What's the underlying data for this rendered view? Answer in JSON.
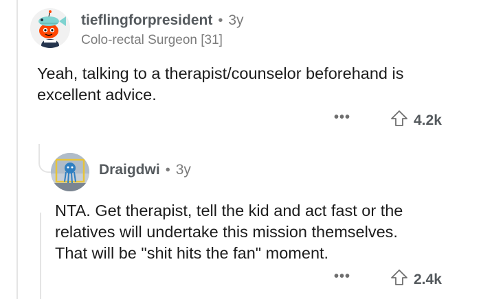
{
  "comments": [
    {
      "username": "tieflingforpresident",
      "separator": "•",
      "age": "3y",
      "flair": "Colo-rectal Surgeon [31]",
      "avatar_icon": "snoo-avatar-icon",
      "body": [
        "Yeah, talking to a therapist/counselor beforehand is",
        "excellent advice."
      ],
      "more_label": "•••",
      "upvotes": "4.2k"
    },
    {
      "username": "Draigdwi",
      "separator": "•",
      "age": "3y",
      "avatar_icon": "draig-avatar-icon",
      "body": [
        "NTA. Get therapist, tell the kid and act fast or the",
        "relatives will undertake this mission themselves.",
        "That will be \"shit hits the fan\" moment."
      ],
      "more_label": "•••",
      "upvotes": "2.4k"
    }
  ],
  "colors": {
    "username": "#555a5e",
    "meta": "#7c7c7c",
    "thread_line": "#e4e4e4",
    "body_text": "#1c1c1c"
  }
}
